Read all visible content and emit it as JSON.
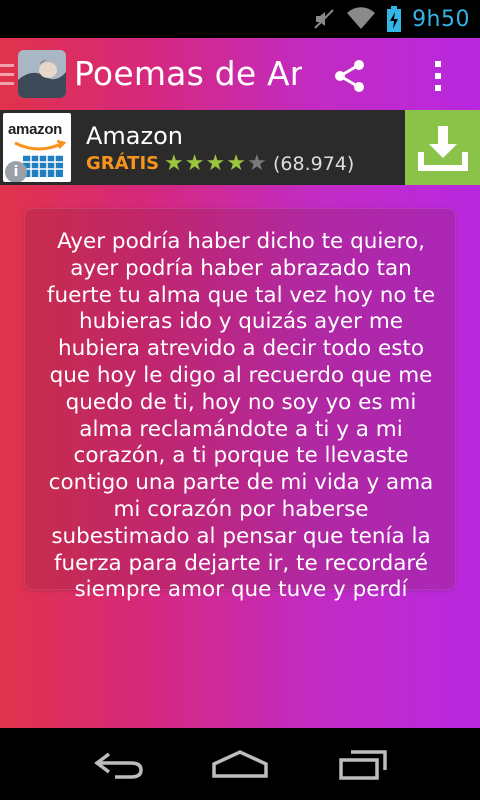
{
  "status_bar": {
    "time": "9h50",
    "icons": [
      "mute-icon",
      "wifi-icon",
      "battery-icon"
    ]
  },
  "action_bar": {
    "title": "Poemas de Ami",
    "icons": [
      "app-icon",
      "share-icon",
      "overflow-menu-icon"
    ]
  },
  "ad": {
    "logo_text": "amazon",
    "app_name": "Amazon",
    "price": "GRÁTIS",
    "rating_stars": 4,
    "rating_max": 5,
    "rating_count": "(68.974)",
    "install_icon": "download-icon",
    "info_icon": "info-icon"
  },
  "poem": {
    "text": "Ayer podría haber dicho te quiero, ayer podría haber abrazado tan fuerte tu alma que tal vez hoy no te hubieras ido y quizás ayer me hubiera atrevido a decir todo esto que hoy le digo al recuerdo que me quedo de ti, hoy no soy yo es mi alma reclamándote a ti y a mi corazón, a ti porque te llevaste contigo una parte de mi vida y ama mi corazón por haberse subestimado al pensar que tenía la fuerza para dejarte ir, te recordaré siempre amor que tuve y perdí"
  },
  "nav_bar": {
    "icons": [
      "back-icon",
      "home-icon",
      "recent-apps-icon"
    ]
  },
  "colors": {
    "status_accent": "#33b5e5",
    "gradient_start": "#e0334a",
    "gradient_end": "#b928e0",
    "ad_background": "#2b2b2b",
    "ad_price": "#f7941d",
    "ad_install": "#8bc34a"
  }
}
